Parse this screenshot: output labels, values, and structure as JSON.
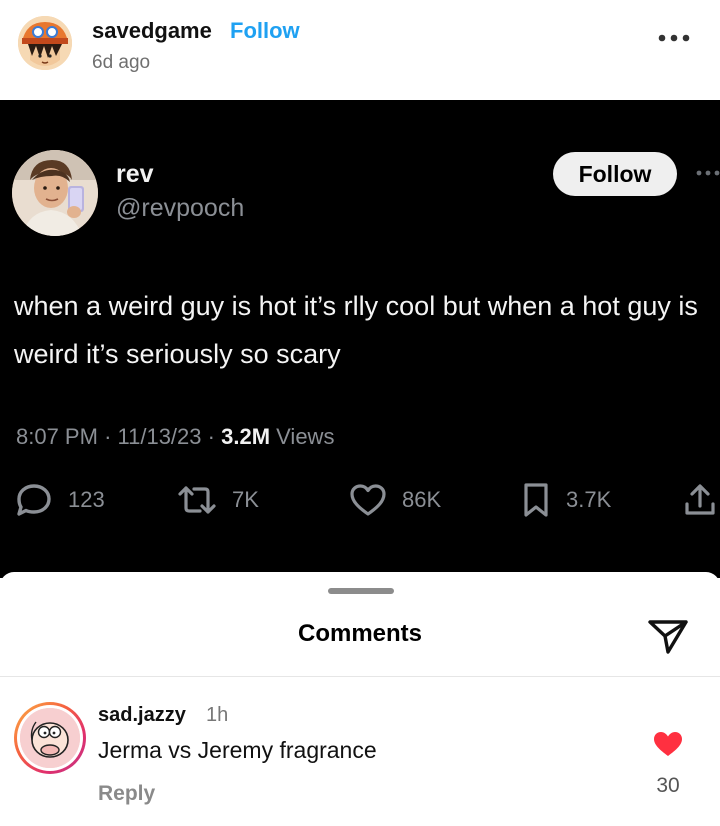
{
  "post": {
    "username": "savedgame",
    "follow_label": "Follow",
    "time_ago": "6d ago",
    "more_icon": "more-horizontal-icon"
  },
  "tweet": {
    "display_name": "rev",
    "handle": "@revpooch",
    "follow_label": "Follow",
    "text": "when a weird guy is hot it’s rlly cool but when a hot guy is weird it’s seriously so scary",
    "time": "8:07 PM",
    "date": "11/13/23",
    "views_count": "3.2M",
    "views_label": "Views",
    "stats": {
      "replies": "123",
      "retweets": "7K",
      "likes": "86K",
      "bookmarks": "3.7K"
    }
  },
  "comments_sheet": {
    "title": "Comments",
    "send_icon": "paper-plane-icon",
    "comment": {
      "username": "sad.jazzy",
      "time_ago": "1h",
      "text": "Jerma vs Jeremy fragrance",
      "reply_label": "Reply",
      "like_count": "30",
      "like_color": "#ff3040"
    }
  },
  "colors": {
    "follow_blue": "#1fa1f2",
    "tweet_bg": "#000000",
    "muted_gray": "#8b8f95"
  }
}
